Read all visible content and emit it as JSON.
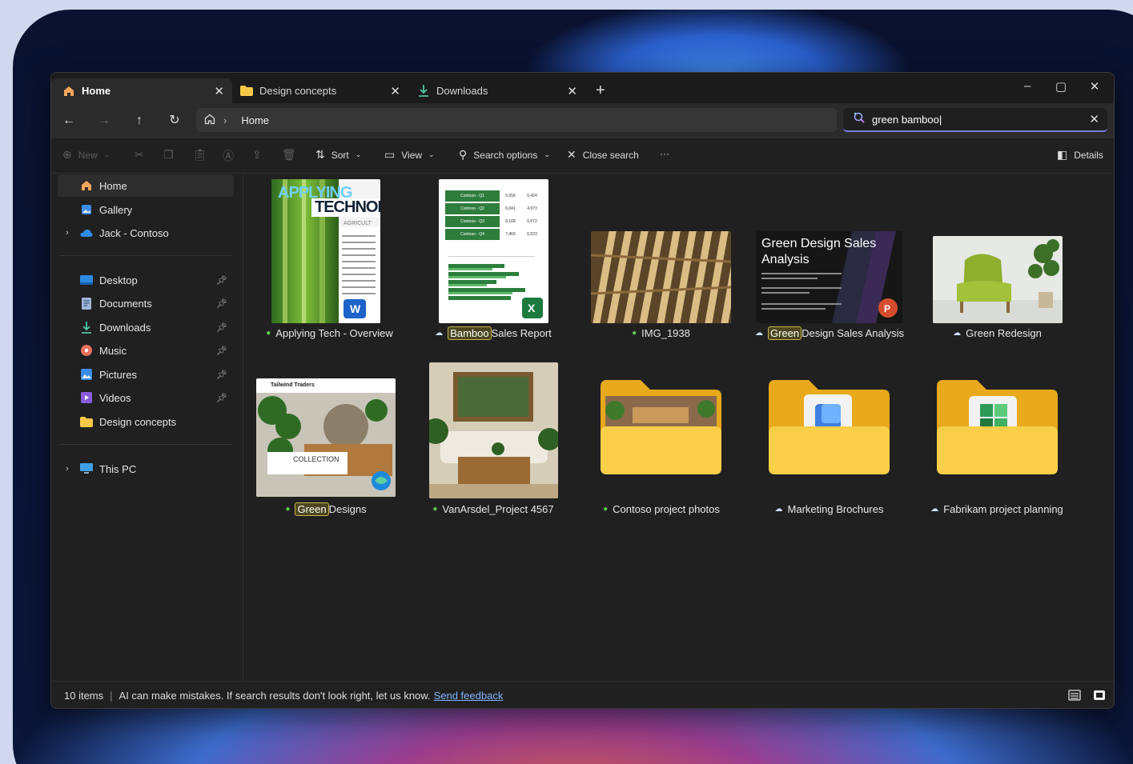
{
  "tabs": [
    {
      "label": "Home",
      "icon": "home-icon"
    },
    {
      "label": "Design concepts",
      "icon": "folder-icon"
    },
    {
      "label": "Downloads",
      "icon": "download-icon"
    }
  ],
  "address": {
    "crumb": "Home"
  },
  "search": {
    "value": "green bamboo|",
    "placeholder": ""
  },
  "toolbar": {
    "new": "New",
    "sort": "Sort",
    "view": "View",
    "search_options": "Search options",
    "close_search": "Close search",
    "more": "···",
    "details": "Details"
  },
  "sidebar": {
    "top": [
      {
        "label": "Home"
      },
      {
        "label": "Gallery"
      },
      {
        "label": "Jack - Contoso"
      }
    ],
    "pinned": [
      {
        "label": "Desktop"
      },
      {
        "label": "Documents"
      },
      {
        "label": "Downloads"
      },
      {
        "label": "Music"
      },
      {
        "label": "Pictures"
      },
      {
        "label": "Videos"
      },
      {
        "label": "Design concepts"
      }
    ],
    "this_pc": "This PC"
  },
  "files": [
    {
      "pre": "",
      "hl": "",
      "post": "Applying Tech - Overview",
      "status": "synced"
    },
    {
      "pre": "",
      "hl": "Bamboo",
      "post": " Sales Report",
      "status": "cloud"
    },
    {
      "pre": "",
      "hl": "",
      "post": "IMG_1938",
      "status": "synced"
    },
    {
      "pre": "",
      "hl": "Green",
      "post": " Design Sales Analysis",
      "status": "cloud"
    },
    {
      "pre": "",
      "hl": "",
      "post": "Green Redesign",
      "status": "cloud"
    },
    {
      "pre": "",
      "hl": "Green",
      "post": " Designs",
      "status": "synced"
    },
    {
      "pre": "",
      "hl": "",
      "post": "VanArsdel_Project 4567",
      "status": "synced"
    },
    {
      "pre": "",
      "hl": "",
      "post": "Contoso project photos",
      "status": "synced"
    },
    {
      "pre": "",
      "hl": "",
      "post": "Marketing Brochures",
      "status": "cloud"
    },
    {
      "pre": "",
      "hl": "",
      "post": "Fabrikam project planning",
      "status": "cloud"
    }
  ],
  "thumb_text": {
    "doc_title_1": "APPLYING",
    "doc_title_2": "TECHNOL",
    "doc_subtitle": "AGRICULT",
    "ppt_title": "Green Design Sales Analysis",
    "tailwind": "Tailwind Traders",
    "collection": "COLLECTION",
    "sheet_rows": [
      {
        "name": "Contoso - Q1",
        "a": "5,556",
        "b": "5,424"
      },
      {
        "name": "Contoso - Q2",
        "a": "6,041",
        "b": "4,973"
      },
      {
        "name": "Contoso - Q3",
        "a": "6,168",
        "b": "6,672"
      },
      {
        "name": "Contoso - Q4",
        "a": "7,460",
        "b": "6,523"
      }
    ]
  },
  "status": {
    "count": "10 items",
    "message": "AI can make mistakes. If search results don't look right, let us know.",
    "feedback": "Send feedback"
  }
}
